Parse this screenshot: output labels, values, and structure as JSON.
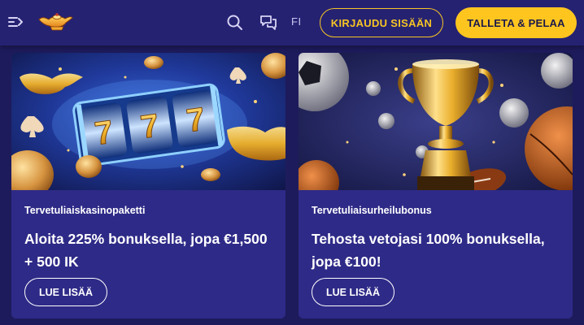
{
  "header": {
    "menu_icon": "menu-collapse-icon",
    "logo_icon": "genie-lamp-logo",
    "search_icon": "search-icon",
    "chat_icon": "chat-icon",
    "language": "FI",
    "login_label": "KIRJAUDU SISÄÄN",
    "deposit_label": "TALLETA & PELAA",
    "accent_color": "#ffc51f",
    "header_bg": "#262272"
  },
  "cards": [
    {
      "image_icon": "slot-machine-777-image",
      "label": "Tervetuliaiskasinopaketti",
      "title": "Aloita 225% bonuksella, jopa €1,500 + 500 IK",
      "button_label": "LUE LISÄÄ"
    },
    {
      "image_icon": "trophy-sports-balls-image",
      "label": "Tervetuliaisurheilubonus",
      "title": "Tehosta vetojasi 100% bonuksella, jopa €100!",
      "button_label": "LUE LISÄÄ"
    }
  ],
  "colors": {
    "page_bg": "#1e1b5c",
    "card_bg": "#2e2a87"
  }
}
